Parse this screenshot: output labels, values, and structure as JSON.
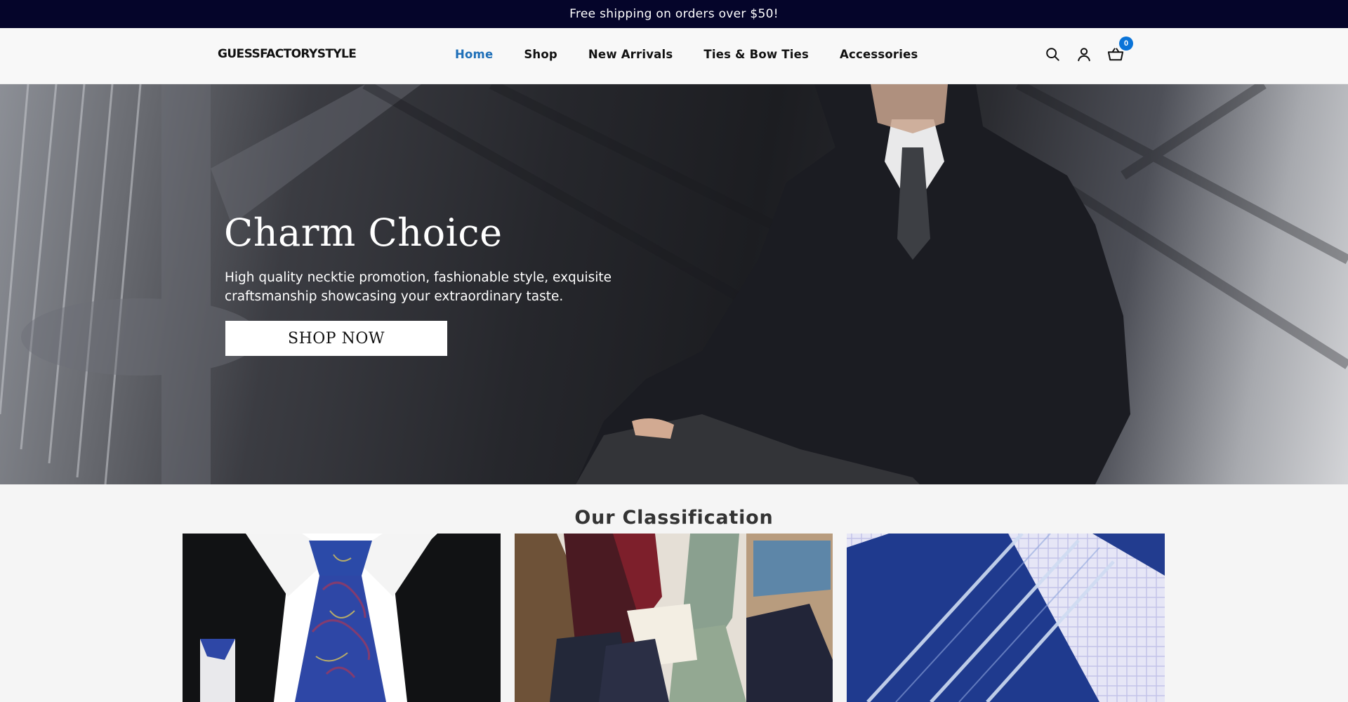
{
  "announcement": {
    "text": "Free shipping on orders over $50!"
  },
  "header": {
    "logo": "GUESSFACTORYSTYLE",
    "nav": [
      {
        "label": "Home",
        "active": true
      },
      {
        "label": "Shop",
        "active": false
      },
      {
        "label": "New Arrivals",
        "active": false
      },
      {
        "label": "Ties & Bow Ties",
        "active": false
      },
      {
        "label": "Accessories",
        "active": false
      }
    ],
    "icons": [
      "search-icon",
      "account-icon",
      "cart-icon"
    ],
    "cart_count": "0",
    "accent_color": "#1e6fb8"
  },
  "hero": {
    "title": "Charm Choice",
    "subtitle": "High quality necktie promotion, fashionable style, exquisite craftsmanship showcasing your extraordinary taste.",
    "button_label": "SHOP NOW"
  },
  "classification": {
    "title": "Our Classification"
  }
}
